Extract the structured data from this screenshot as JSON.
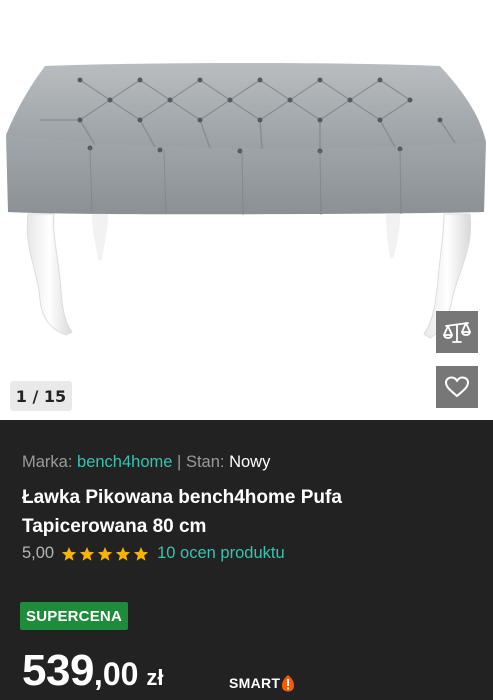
{
  "gallery": {
    "counter": "1 / 15",
    "image_alt": "Ławka pikowana szara na białych nogach",
    "compare_icon": "scales-icon",
    "favorite_icon": "heart-icon"
  },
  "product": {
    "brand_label": "Marka:",
    "brand_value": "bench4home",
    "separator": "|",
    "condition_label": "Stan:",
    "condition_value": "Nowy",
    "title": "Ławka Pikowana bench4home Pufa Tapicerowana 80 cm",
    "rating_score": "5,00",
    "stars": 5,
    "rating_count_text": "10 ocen produktu",
    "badge": "SUPERCENA",
    "price_integer": "539",
    "price_decimal": ",00",
    "price_currency": "zł",
    "smart_label": "SMART"
  },
  "colors": {
    "background": "#222222",
    "link": "#38c2b1",
    "badge": "#1e8c3a",
    "star": "#f5b500",
    "smart_accent": "#ff5a00"
  }
}
